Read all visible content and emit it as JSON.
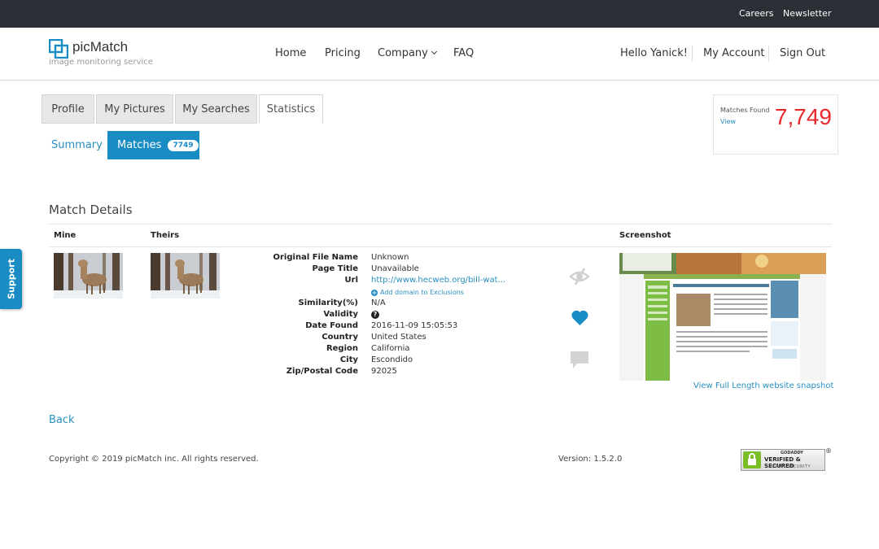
{
  "topbar": {
    "careers": "Careers",
    "newsletter": "Newsletter"
  },
  "brand": {
    "name": "picMatch",
    "tagline": "image monitoring service",
    "accent": "#1a8cc4"
  },
  "nav": {
    "home": "Home",
    "pricing": "Pricing",
    "company": "Company",
    "faq": "FAQ"
  },
  "user": {
    "greeting": "Hello Yanick!",
    "account": "My Account",
    "signout": "Sign Out"
  },
  "tabs": [
    {
      "label": "Profile"
    },
    {
      "label": "My Pictures"
    },
    {
      "label": "My Searches"
    },
    {
      "label": "Statistics",
      "active": true
    }
  ],
  "subtabs": {
    "summary": "Summary",
    "matches": "Matches",
    "matches_count": "7749"
  },
  "found": {
    "label": "Matches Found",
    "view": "View",
    "count": "7,749",
    "color": "#e8282b"
  },
  "details": {
    "title": "Match Details",
    "columns": {
      "mine": "Mine",
      "theirs": "Theirs",
      "screenshot": "Screenshot"
    },
    "fields": [
      {
        "label": "Original File Name",
        "value": "Unknown"
      },
      {
        "label": "Page Title",
        "value": "Unavailable"
      },
      {
        "label": "Url",
        "value": "http://www.hecweb.org/bill-wat..."
      },
      {
        "label": "Similarity(%)",
        "value": "N/A"
      },
      {
        "label": "Validity",
        "value": ""
      },
      {
        "label": "Date Found",
        "value": "2016-11-09 15:05:53"
      },
      {
        "label": "Country",
        "value": "United States"
      },
      {
        "label": "Region",
        "value": "California"
      },
      {
        "label": "City",
        "value": "Escondido"
      },
      {
        "label": "Zip/Postal Code",
        "value": "92025"
      }
    ],
    "add_domain": "Add domain to Exclusions",
    "snapshot_link": "View Full Length website snapshot",
    "icons": [
      "hide-icon",
      "heart-icon",
      "comment-icon",
      "help-icon"
    ]
  },
  "back": "Back",
  "footer": {
    "copyright": "Copyright © 2019 picMatch inc. All rights reserved.",
    "version": "Version: 1.5.2.0"
  },
  "seal": {
    "top": "GODADDY",
    "main": "VERIFIED & SECURED",
    "sub": "VERIFY SECURITY",
    "registered": "®"
  },
  "support": "Support"
}
